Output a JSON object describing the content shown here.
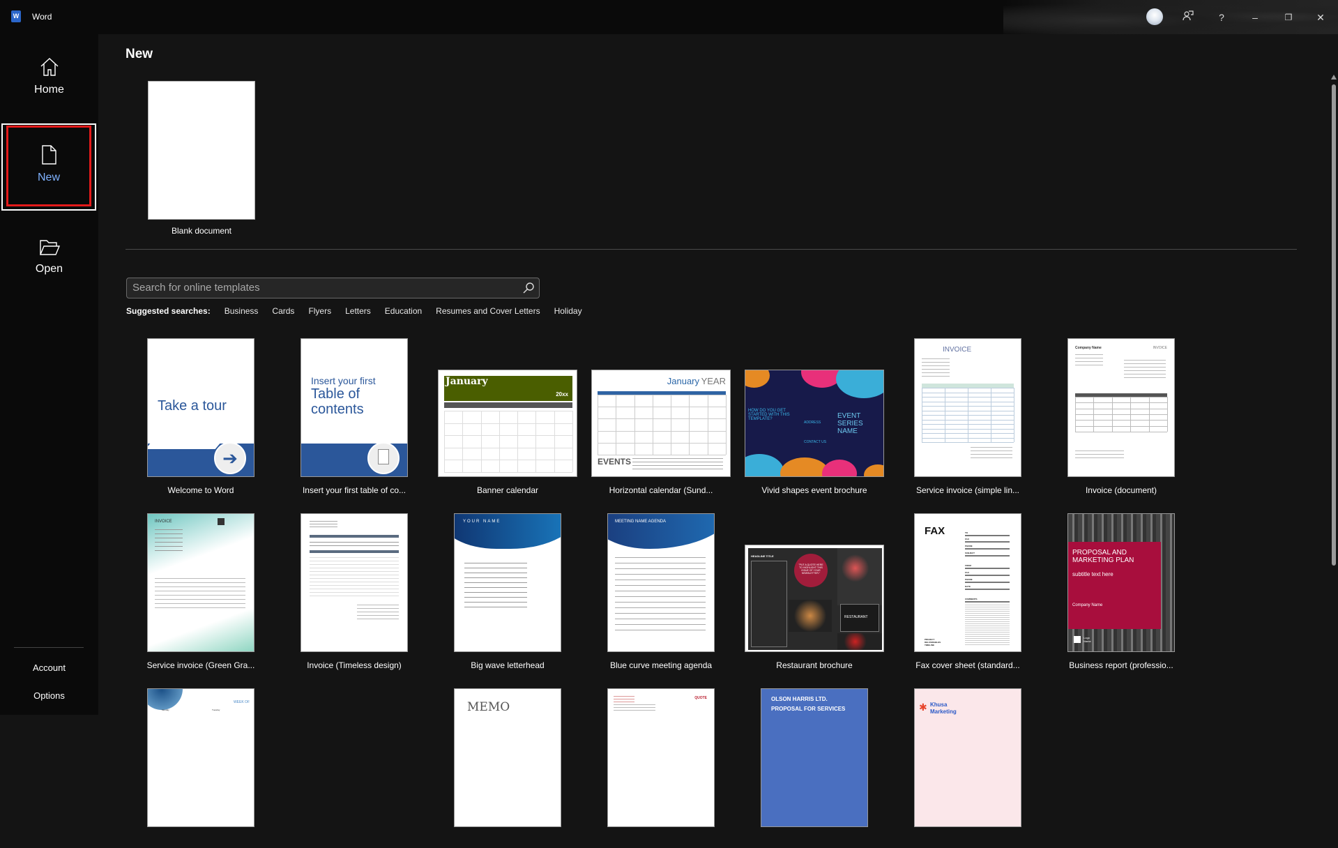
{
  "titlebar": {
    "app_name": "Word",
    "app_logo": "W",
    "buttons": [
      "avatar",
      "feedback-icon",
      "help-icon",
      "minimize-icon",
      "restore-icon",
      "close-icon"
    ],
    "help": "?",
    "minimize": "–",
    "restore": "❐",
    "close": "✕"
  },
  "sidebar": {
    "items": [
      {
        "id": "home",
        "label": "Home",
        "icon": "home-icon"
      },
      {
        "id": "new",
        "label": "New",
        "icon": "new-document-icon",
        "selected": true
      },
      {
        "id": "open",
        "label": "Open",
        "icon": "folder-open-icon"
      }
    ],
    "bottom": [
      {
        "label": "Account"
      },
      {
        "label": "Options"
      }
    ]
  },
  "main": {
    "title": "New",
    "blank": {
      "label": "Blank document"
    },
    "search": {
      "placeholder": "Search for online templates",
      "icon": "search-icon"
    },
    "suggested": {
      "label": "Suggested searches:",
      "items": [
        "Business",
        "Cards",
        "Flyers",
        "Letters",
        "Education",
        "Resumes and Cover Letters",
        "Holiday"
      ]
    },
    "templates": [
      {
        "id": "tour",
        "label": "Welcome to Word",
        "text": [
          "Take a tour"
        ]
      },
      {
        "id": "toc",
        "label": "Insert your first table of co...",
        "text": [
          "Insert your first",
          "Table of",
          "contents"
        ]
      },
      {
        "id": "banner",
        "label": "Banner calendar",
        "text": [
          "January",
          "20xx"
        ]
      },
      {
        "id": "hcal",
        "label": "Horizontal calendar (Sund...",
        "text": [
          "January",
          "YEAR",
          "EVENTS"
        ]
      },
      {
        "id": "vivid",
        "label": "Vivid shapes event brochure",
        "text": [
          "HOW DO YOU GET STARTED WITH THIS TEMPLATE?",
          "ADDRESS",
          "CONTACT US",
          "EVENT SERIES NAME"
        ]
      },
      {
        "id": "sinv",
        "label": "Service invoice (simple lin...",
        "text": [
          "INVOICE"
        ]
      },
      {
        "id": "inv",
        "label": "Invoice (document)",
        "text": [
          "Company Name",
          "INVOICE"
        ]
      },
      {
        "id": "green",
        "label": "Service invoice (Green Gra...",
        "text": [
          "INVOICE"
        ]
      },
      {
        "id": "timeless",
        "label": "Invoice (Timeless design)",
        "text": []
      },
      {
        "id": "wave",
        "label": "Big wave letterhead",
        "text": [
          "YOUR NAME"
        ]
      },
      {
        "id": "agenda",
        "label": "Blue curve meeting agenda",
        "text": [
          "MEETING NAME AGENDA"
        ]
      },
      {
        "id": "rest",
        "label": "Restaurant brochure",
        "text": [
          "HEADLINE TITLE",
          "\"PUT A QUOTE HERE TO HIGHLIGHT THIS ISSUE OF YOUR NEWSLETTER.\"",
          "RESTAURANT"
        ]
      },
      {
        "id": "fax",
        "label": "Fax cover sheet (standard...",
        "text": [
          "FAX",
          "TO",
          "FAX",
          "PHONE",
          "SUBJECT",
          "FROM",
          "FAX",
          "PHONE",
          "DATE",
          "COMMENTS",
          "PROJECT DELIVERABLES TIMELINE"
        ]
      },
      {
        "id": "biz",
        "label": "Business report (professio...",
        "text": [
          "PROPOSAL AND MARKETING PLAN",
          "subtitle text here",
          "Company Name",
          "Logo Name"
        ]
      },
      {
        "id": "week",
        "label": "",
        "text": [
          "WEEK OF",
          "Monday",
          "Tuesday"
        ]
      },
      {
        "id": "none",
        "label": "",
        "text": []
      },
      {
        "id": "memo",
        "label": "",
        "text": [
          "MEMO"
        ]
      },
      {
        "id": "quote",
        "label": "",
        "text": [
          "QUOTE"
        ]
      },
      {
        "id": "olson",
        "label": "",
        "text": [
          "OLSON HARRIS LTD.",
          "PROPOSAL FOR SERVICES"
        ]
      },
      {
        "id": "khusa",
        "label": "",
        "text": [
          "Khusa",
          "Marketing"
        ]
      }
    ]
  },
  "colors": {
    "accent": "#7fb2ff",
    "selected_outline": "#e41a1a",
    "word_blue": "#2b66c9"
  }
}
